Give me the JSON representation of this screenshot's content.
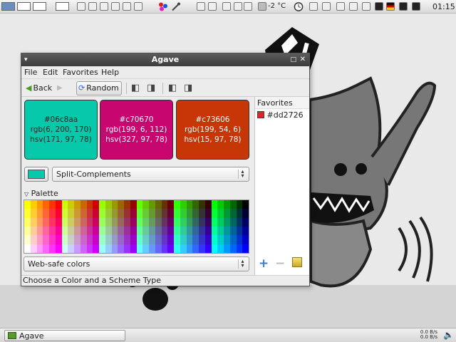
{
  "top_panel": {
    "temperature": "-2 °C",
    "clock": "01:15"
  },
  "window": {
    "title": "Agave",
    "menu": [
      "File",
      "Edit",
      "Favorites",
      "Help"
    ],
    "toolbar": {
      "back_label": "Back",
      "random_label": "Random"
    },
    "swatches": [
      {
        "hex": "#06c8aa",
        "rgb": "rgb(6, 200, 170)",
        "hsv": "hsv(171, 97, 78)",
        "color": "#06c8aa",
        "text_color": "#222222"
      },
      {
        "hex": "#c70670",
        "rgb": "rgb(199, 6, 112)",
        "hsv": "hsv(327, 97, 78)",
        "color": "#c70670",
        "text_color": "#ffffff"
      },
      {
        "hex": "#c73606",
        "rgb": "rgb(199, 54, 6)",
        "hsv": "hsv(15, 97, 78)",
        "color": "#c73606",
        "text_color": "#ffffff"
      }
    ],
    "scheme": {
      "current_color": "#06c8aa",
      "selected": "Split-Complements"
    },
    "palette": {
      "label": "Palette",
      "selected": "Web-safe colors"
    },
    "favorites": {
      "header": "Favorites",
      "items": [
        {
          "hex": "#dd2726",
          "color": "#dd2726"
        }
      ]
    },
    "status": "Choose a Color and a Scheme Type"
  },
  "taskbar": {
    "task_label": "Agave",
    "net_up": "0.0 B/s",
    "net_down": "0.0 B/s"
  }
}
